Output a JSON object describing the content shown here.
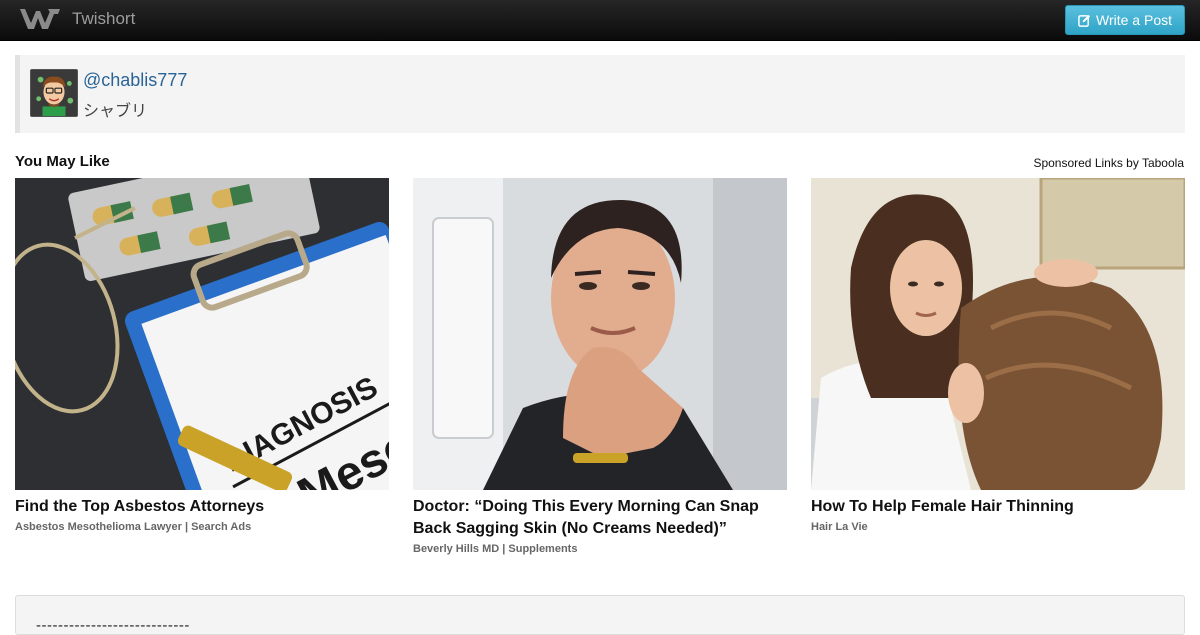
{
  "navbar": {
    "brand": "Twishort",
    "write_button": "Write a Post"
  },
  "profile": {
    "handle": "@chablis777",
    "display_name": "シャブリ"
  },
  "recommendations": {
    "heading": "You May Like",
    "sponsored_label": "Sponsored Links by Taboola",
    "cards": [
      {
        "title": "Find the Top Asbestos Attorneys",
        "source": "Asbestos Mesothelioma Lawyer | Search Ads",
        "image_text_1": "DIAGNOSIS",
        "image_text_2": "Mesot"
      },
      {
        "title": "Doctor: “Doing This Every Morning Can Snap Back Sagging Skin (No Creams Needed)”",
        "source": "Beverly Hills MD | Supplements"
      },
      {
        "title": "How To Help Female Hair Thinning",
        "source": "Hair La Vie"
      }
    ]
  },
  "post": {
    "text": "----------------------------"
  },
  "colors": {
    "accent": "#5bc0de",
    "link": "#2a6496",
    "navbar": "#1b1b1b"
  }
}
